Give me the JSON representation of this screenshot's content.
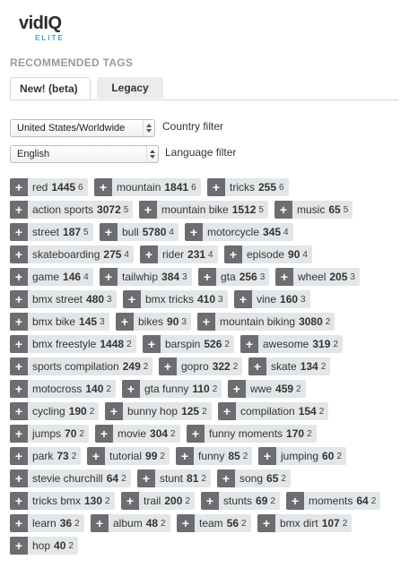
{
  "brand": {
    "name": "vidIQ",
    "tier": "ELITE",
    "accent": "#39a0d8"
  },
  "section_title": "RECOMMENDED TAGS",
  "tabs": [
    {
      "label": "New! (beta)",
      "active": true
    },
    {
      "label": "Legacy",
      "active": false
    }
  ],
  "filters": {
    "country": {
      "value": "United States/Worldwide",
      "label": "Country filter"
    },
    "language": {
      "value": "English",
      "label": "Language filter"
    }
  },
  "tag_rows": [
    [
      {
        "tag": "red",
        "volume": "1445",
        "rank": "6"
      },
      {
        "tag": "mountain",
        "volume": "1841",
        "rank": "6"
      },
      {
        "tag": "tricks",
        "volume": "255",
        "rank": "6"
      }
    ],
    [
      {
        "tag": "action sports",
        "volume": "3072",
        "rank": "5"
      },
      {
        "tag": "mountain bike",
        "volume": "1512",
        "rank": "5"
      },
      {
        "tag": "music",
        "volume": "65",
        "rank": "5"
      }
    ],
    [
      {
        "tag": "street",
        "volume": "187",
        "rank": "5"
      },
      {
        "tag": "bull",
        "volume": "5780",
        "rank": "4"
      },
      {
        "tag": "motorcycle",
        "volume": "345",
        "rank": "4"
      }
    ],
    [
      {
        "tag": "skateboarding",
        "volume": "275",
        "rank": "4"
      },
      {
        "tag": "rider",
        "volume": "231",
        "rank": "4"
      },
      {
        "tag": "episode",
        "volume": "90",
        "rank": "4"
      }
    ],
    [
      {
        "tag": "game",
        "volume": "146",
        "rank": "4"
      },
      {
        "tag": "tailwhip",
        "volume": "384",
        "rank": "3"
      },
      {
        "tag": "gta",
        "volume": "256",
        "rank": "3"
      },
      {
        "tag": "wheel",
        "volume": "205",
        "rank": "3"
      }
    ],
    [
      {
        "tag": "bmx street",
        "volume": "480",
        "rank": "3"
      },
      {
        "tag": "bmx tricks",
        "volume": "410",
        "rank": "3"
      },
      {
        "tag": "vine",
        "volume": "160",
        "rank": "3"
      }
    ],
    [
      {
        "tag": "bmx bike",
        "volume": "145",
        "rank": "3"
      },
      {
        "tag": "bikes",
        "volume": "90",
        "rank": "3"
      },
      {
        "tag": "mountain biking",
        "volume": "3080",
        "rank": "2"
      }
    ],
    [
      {
        "tag": "bmx freestyle",
        "volume": "1448",
        "rank": "2"
      },
      {
        "tag": "barspin",
        "volume": "526",
        "rank": "2"
      },
      {
        "tag": "awesome",
        "volume": "319",
        "rank": "2"
      }
    ],
    [
      {
        "tag": "sports compilation",
        "volume": "249",
        "rank": "2"
      },
      {
        "tag": "gopro",
        "volume": "322",
        "rank": "2"
      },
      {
        "tag": "skate",
        "volume": "134",
        "rank": "2"
      }
    ],
    [
      {
        "tag": "motocross",
        "volume": "140",
        "rank": "2"
      },
      {
        "tag": "gta funny",
        "volume": "110",
        "rank": "2"
      },
      {
        "tag": "wwe",
        "volume": "459",
        "rank": "2"
      }
    ],
    [
      {
        "tag": "cycling",
        "volume": "190",
        "rank": "2"
      },
      {
        "tag": "bunny hop",
        "volume": "125",
        "rank": "2"
      },
      {
        "tag": "compilation",
        "volume": "154",
        "rank": "2"
      }
    ],
    [
      {
        "tag": "jumps",
        "volume": "70",
        "rank": "2"
      },
      {
        "tag": "movie",
        "volume": "304",
        "rank": "2"
      },
      {
        "tag": "funny moments",
        "volume": "170",
        "rank": "2"
      }
    ],
    [
      {
        "tag": "park",
        "volume": "73",
        "rank": "2"
      },
      {
        "tag": "tutorial",
        "volume": "99",
        "rank": "2"
      },
      {
        "tag": "funny",
        "volume": "85",
        "rank": "2"
      },
      {
        "tag": "jumping",
        "volume": "60",
        "rank": "2"
      }
    ],
    [
      {
        "tag": "stevie churchill",
        "volume": "64",
        "rank": "2"
      },
      {
        "tag": "stunt",
        "volume": "81",
        "rank": "2"
      },
      {
        "tag": "song",
        "volume": "65",
        "rank": "2"
      }
    ],
    [
      {
        "tag": "tricks bmx",
        "volume": "130",
        "rank": "2"
      },
      {
        "tag": "trail",
        "volume": "200",
        "rank": "2"
      },
      {
        "tag": "stunts",
        "volume": "69",
        "rank": "2"
      },
      {
        "tag": "moments",
        "volume": "64",
        "rank": "2"
      }
    ],
    [
      {
        "tag": "learn",
        "volume": "36",
        "rank": "2"
      },
      {
        "tag": "album",
        "volume": "48",
        "rank": "2"
      },
      {
        "tag": "team",
        "volume": "56",
        "rank": "2"
      },
      {
        "tag": "bmx dirt",
        "volume": "107",
        "rank": "2"
      }
    ],
    [
      {
        "tag": "hop",
        "volume": "40",
        "rank": "2"
      }
    ]
  ]
}
